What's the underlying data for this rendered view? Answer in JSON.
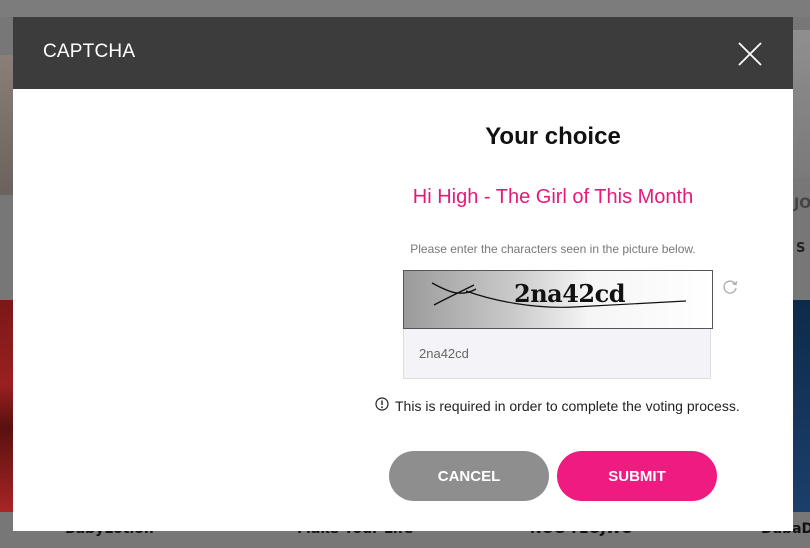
{
  "modal": {
    "title": "CAPTCHA",
    "heading": "Your choice",
    "song": "Hi High - The Girl of This Month",
    "instruction": "Please enter the characters seen in the picture below.",
    "captcha_text": "2na42cd",
    "input_value": "2na42cd",
    "notice": "This is required in order to complete the voting process.",
    "cancel_label": "CANCEL",
    "submit_label": "SUBMIT",
    "icons": [
      "close-icon",
      "refresh-icon",
      "info-icon"
    ],
    "colors": {
      "header": "#3c3c3c",
      "accent": "#ef1b80",
      "cancel": "#8e8e8e"
    }
  },
  "background": {
    "captions": [
      "BabyLotion",
      "Make Your Life",
      "NOG-YEOJWO",
      "DabaDa"
    ],
    "side_text_1": "JO",
    "side_text_2": "S"
  }
}
